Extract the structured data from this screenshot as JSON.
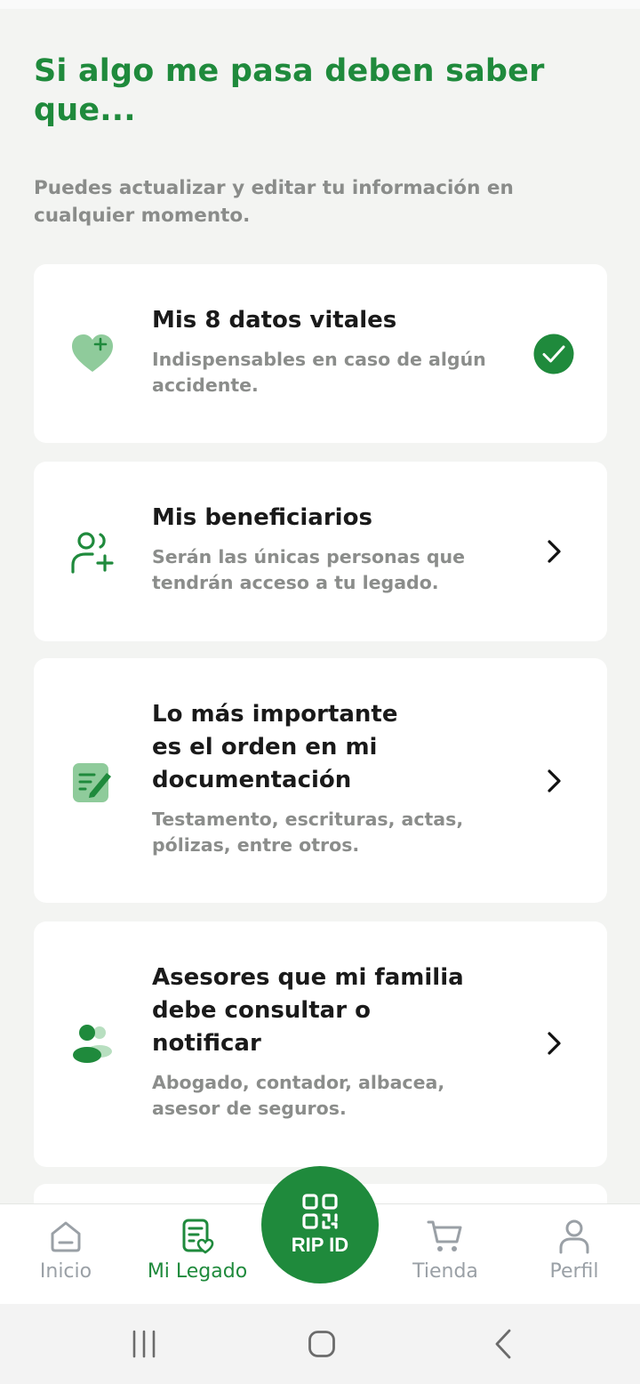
{
  "header": {
    "title": "Si algo me pasa deben saber que...",
    "subtitle": "Puedes actualizar y editar tu información en cualquier momento."
  },
  "cards": [
    {
      "icon": "heart-plus-icon",
      "title": "Mis 8 datos vitales",
      "description": "Indispensables en caso de algún accidente.",
      "status": "completed-check-icon"
    },
    {
      "icon": "add-person-icon",
      "title": "Mis beneficiarios",
      "description": "Serán las únicas personas que tendrán acceso a tu legado.",
      "status": "chevron-right-icon"
    },
    {
      "icon": "document-edit-icon",
      "title": "Lo más importante es el orden en mi documentación",
      "description": "Testamento, escrituras, actas, pólizas, entre otros.",
      "status": "chevron-right-icon"
    },
    {
      "icon": "advisors-icon",
      "title": "Asesores que mi familia debe consultar o notificar",
      "description": "Abogado, contador, albacea, asesor de seguros.",
      "status": "chevron-right-icon"
    }
  ],
  "nav": {
    "items": [
      {
        "label": "Inicio",
        "icon": "home-icon"
      },
      {
        "label": "Mi Legado",
        "icon": "legacy-document-icon",
        "active": true
      },
      {
        "label": "Tienda",
        "icon": "cart-icon"
      },
      {
        "label": "Perfil",
        "icon": "profile-icon"
      }
    ],
    "center": {
      "label": "RIP ID",
      "icon": "qr-code-icon"
    }
  },
  "colors": {
    "brand_green": "#1f8a3c",
    "light_green": "#8fcb9b",
    "background": "#f3f4f2",
    "muted_text": "#8b8d8b",
    "inactive_nav": "#9aa0a6"
  }
}
